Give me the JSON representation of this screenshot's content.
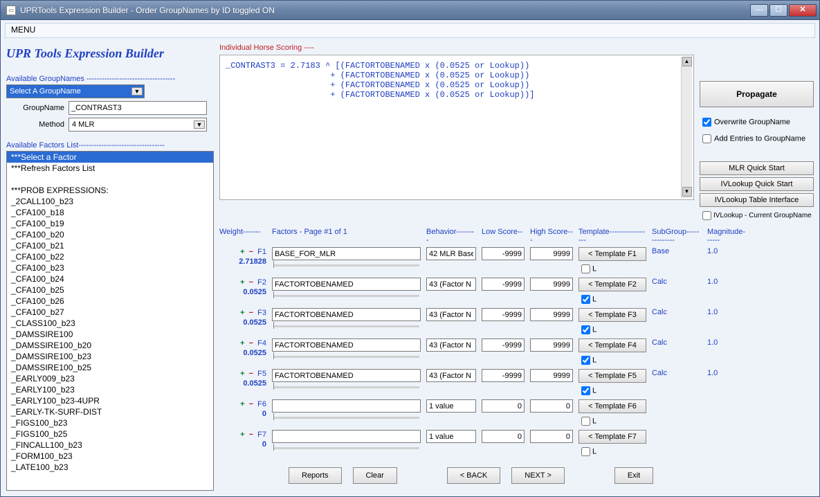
{
  "title": "UPRTools Expression Builder - Order GroupNames by ID toggled ON",
  "menu": "MENU",
  "app_title": "UPR Tools Expression Builder",
  "left": {
    "avail_group_hdr": "Available GroupNames -----------------------------------",
    "group_select": "Select A GroupName",
    "groupname_label": "GroupName",
    "groupname_value": "_CONTRAST3",
    "method_label": "Method",
    "method_value": "4 MLR",
    "avail_factors_hdr": "Available Factors List----------------------------------",
    "factors": [
      "***Select a Factor",
      "***Refresh Factors List",
      "",
      "***PROB EXPRESSIONS:",
      "_2CALL100_b23",
      "_CFA100_b18",
      "_CFA100_b19",
      "_CFA100_b20",
      "_CFA100_b21",
      "_CFA100_b22",
      "_CFA100_b23",
      "_CFA100_b24",
      "_CFA100_b25",
      "_CFA100_b26",
      "_CFA100_b27",
      "_CLASS100_b23",
      "_DAMSSIRE100",
      "_DAMSSIRE100_b20",
      "_DAMSSIRE100_b23",
      "_DAMSSIRE100_b25",
      "_EARLY009_b23",
      "_EARLY100_b23",
      "_EARLY100_b23-4UPR",
      "_EARLY-TK-SURF-DIST",
      "_FIGS100_b23",
      "_FIGS100_b25",
      "_FINCALL100_b23",
      "_FORM100_b23",
      "_LATE100_b23"
    ]
  },
  "scoring_hdr": "Individual Horse Scoring ----",
  "expression": "_CONTRAST3 = 2.7183 ^ [(FACTORTOBENAMED x (0.0525 or Lookup))\n                     + (FACTORTOBENAMED x (0.0525 or Lookup))\n                     + (FACTORTOBENAMED x (0.0525 or Lookup))\n                     + (FACTORTOBENAMED x (0.0525 or Lookup))]",
  "headers": {
    "weight": "Weight-------",
    "factors": "Factors - Page #1 of 1",
    "behavior": "Behavior--------",
    "low": "Low Score--",
    "high": "High Score---",
    "template": "Template-----------------",
    "sub": "SubGroup--------------",
    "mag": "Magnitude------"
  },
  "rows": [
    {
      "id": "F1",
      "w": "2.71828",
      "factor": "BASE_FOR_MLR",
      "behavior": "42 MLR Base",
      "low": "-9999",
      "high": "9999",
      "tpl": "< Template F1",
      "lchk": false,
      "sub": "Base",
      "mag": "1.0"
    },
    {
      "id": "F2",
      "w": "0.0525",
      "factor": "FACTORTOBENAMED",
      "behavior": "43 (Factor N",
      "low": "-9999",
      "high": "9999",
      "tpl": "< Template F2",
      "lchk": true,
      "sub": "Calc",
      "mag": "1.0"
    },
    {
      "id": "F3",
      "w": "0.0525",
      "factor": "FACTORTOBENAMED",
      "behavior": "43 (Factor N",
      "low": "-9999",
      "high": "9999",
      "tpl": "< Template F3",
      "lchk": true,
      "sub": "Calc",
      "mag": "1.0"
    },
    {
      "id": "F4",
      "w": "0.0525",
      "factor": "FACTORTOBENAMED",
      "behavior": "43 (Factor N",
      "low": "-9999",
      "high": "9999",
      "tpl": "< Template F4",
      "lchk": true,
      "sub": "Calc",
      "mag": "1.0"
    },
    {
      "id": "F5",
      "w": "0.0525",
      "factor": "FACTORTOBENAMED",
      "behavior": "43 (Factor N",
      "low": "-9999",
      "high": "9999",
      "tpl": "< Template F5",
      "lchk": true,
      "sub": "Calc",
      "mag": "1.0"
    },
    {
      "id": "F6",
      "w": "0",
      "factor": "",
      "behavior": "1 value",
      "low": "0",
      "high": "0",
      "tpl": "< Template F6",
      "lchk": false,
      "sub": "",
      "mag": ""
    },
    {
      "id": "F7",
      "w": "0",
      "factor": "",
      "behavior": "1 value",
      "low": "0",
      "high": "0",
      "tpl": "< Template F7",
      "lchk": false,
      "sub": "",
      "mag": ""
    }
  ],
  "bottom": {
    "reports": "Reports",
    "clear": "Clear",
    "back": "< BACK",
    "next": "NEXT >",
    "exit": "Exit"
  },
  "right": {
    "propagate": "Propagate",
    "overwrite": "Overwrite GroupName",
    "addentries": "Add Entries to GroupName",
    "mlr": "MLR Quick Start",
    "ivqs": "IVLookup Quick Start",
    "ivtable": "IVLookup Table Interface",
    "ivchk": "IVLookup - Current GroupName",
    "overwrite_checked": true,
    "addentries_checked": false,
    "ivchk_checked": false
  },
  "l_label": "L"
}
